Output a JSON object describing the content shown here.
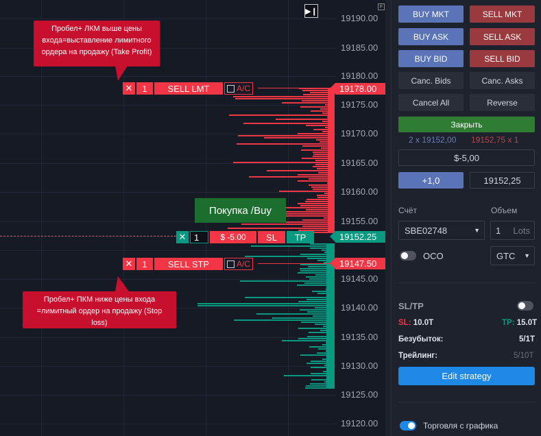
{
  "chart": {
    "play_icon": "play-next-icon",
    "f_label": "F",
    "price_axis": [
      "19190.00",
      "19185.00",
      "19180.00",
      "19175.00",
      "19170.00",
      "19165.00",
      "19160.00",
      "19155.00",
      "19145.00",
      "19140.00",
      "19135.00",
      "19130.00",
      "19125.00",
      "19120.00"
    ],
    "callout_top": "Пробел+ ЛКМ выше цены входа=выставление лимитного ордера на продажу (Take Profit)",
    "callout_bottom": "Пробел+ ПКМ ниже цены входа =лимитный ордер на продажу (Stop loss)",
    "sell_lmt": {
      "qty": "1",
      "label": "SELL LMT",
      "ac": "A/C",
      "price": "19178.00"
    },
    "sell_stp": {
      "qty": "1",
      "label": "SELL STP",
      "ac": "A/C",
      "price": "19147.50"
    },
    "position": {
      "qty": "1",
      "pl": "$ -5.00",
      "sl": "SL",
      "tp": "TP",
      "price": "19152.25"
    },
    "buy_label": "Покупка /Buy"
  },
  "panel": {
    "buy_mkt": "BUY MKT",
    "sell_mkt": "SELL MKT",
    "buy_ask": "BUY ASK",
    "sell_ask": "SELL ASK",
    "buy_bid": "BUY BID",
    "sell_bid": "SELL BID",
    "canc_bids": "Canc. Bids",
    "canc_asks": "Canc. Asks",
    "cancel_all": "Cancel All",
    "reverse": "Reverse",
    "close": "Закрыть",
    "bid_quote": "2 x 19152,00",
    "ask_quote": "19152,75 x 1",
    "pnl": "$-5,00",
    "qty_step": "+1,0",
    "price_field": "19152,25",
    "account_label": "Счёт",
    "volume_label": "Объем",
    "account": "SBE02748",
    "volume": "1",
    "volume_unit": "Lots",
    "oco": "OCO",
    "tif": "GTC",
    "sltp_title": "SL/TP",
    "sl_label": "SL:",
    "sl_value": "10.0T",
    "tp_label": "TP:",
    "tp_value": "15.0T",
    "breakeven_label": "Безубыток:",
    "breakeven_value": "5/1T",
    "trailing_label": "Трейлинг:",
    "trailing_value": "5/10T",
    "edit_strategy": "Edit strategy",
    "chart_trading": "Торговля с графика"
  },
  "colors": {
    "ask": "#f23645",
    "bid": "#089981",
    "accent": "#1e88e5"
  }
}
